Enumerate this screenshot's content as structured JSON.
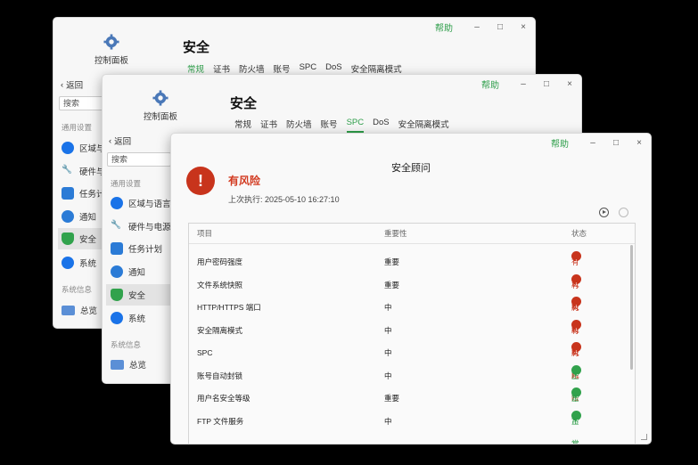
{
  "window_back2": {
    "help": "帮助",
    "cp_title": "控制面板",
    "page_title": "安全",
    "tabs": [
      "常规",
      "证书",
      "防火墙",
      "账号",
      "SPC",
      "DoS",
      "安全隔离模式"
    ],
    "back": "返回",
    "search": "搜索",
    "section_general": "通用设置",
    "items": [
      "区域与",
      "硬件与",
      "任务计",
      "通知",
      "安全",
      "系统"
    ],
    "section_info": "系统信息",
    "overview": "总览"
  },
  "window_back1": {
    "help": "帮助",
    "cp_title": "控制面板",
    "page_title": "安全",
    "tabs": [
      "常规",
      "证书",
      "防火墙",
      "账号",
      "SPC",
      "DoS",
      "安全隔离模式"
    ],
    "back": "返回",
    "search": "搜索",
    "section_general": "通用设置",
    "items": [
      "区域与语言",
      "硬件与电源",
      "任务计划",
      "通知",
      "安全",
      "系统"
    ],
    "section_info": "系统信息",
    "overview": "总览"
  },
  "advisor": {
    "help": "帮助",
    "title": "安全顾问",
    "risk_title": "有风险",
    "last_run": "上次执行: 2025-05-10 16:27:10",
    "columns": [
      "项目",
      "重要性",
      "状态"
    ],
    "rows": [
      {
        "item": "用户密码强度",
        "importance": "重要",
        "status": "有风险",
        "level": "risk"
      },
      {
        "item": "文件系统快照",
        "importance": "重要",
        "status": "有风险",
        "level": "risk"
      },
      {
        "item": "HTTP/HTTPS 端口",
        "importance": "中",
        "status": "有风险",
        "level": "risk"
      },
      {
        "item": "安全隔离模式",
        "importance": "中",
        "status": "有风险",
        "level": "risk"
      },
      {
        "item": "SPC",
        "importance": "中",
        "status": "有风险",
        "level": "risk"
      },
      {
        "item": "账号自动封锁",
        "importance": "中",
        "status": "正常",
        "level": "ok"
      },
      {
        "item": "用户名安全等级",
        "importance": "重要",
        "status": "正常",
        "level": "ok"
      },
      {
        "item": "FTP 文件服务",
        "importance": "中",
        "status": "正常",
        "level": "ok"
      }
    ]
  },
  "colors": {
    "accent": "#2e9e4a",
    "risk": "#c8341c"
  }
}
